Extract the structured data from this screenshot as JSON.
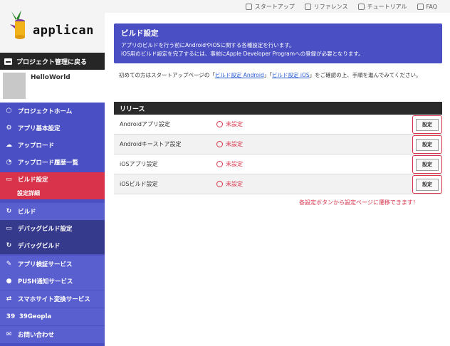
{
  "app": {
    "logo_text": "applican"
  },
  "topbar": {
    "links": [
      "スタートアップ",
      "リファレンス",
      "チュートリアル",
      "FAQ"
    ]
  },
  "sidebar": {
    "back_label": "プロジェクト管理に戻る",
    "project_name": "HelloWorld",
    "items": [
      {
        "label": "プロジェクトホーム",
        "icon": "cube-icon"
      },
      {
        "label": "アプリ基本設定",
        "icon": "gear-icon"
      },
      {
        "label": "アップロード",
        "icon": "cloud-upload-icon"
      },
      {
        "label": "アップロード履歴一覧",
        "icon": "history-icon"
      },
      {
        "label": "ビルド設定",
        "icon": "briefcase-icon"
      },
      {
        "label": "設定詳細",
        "icon": ""
      },
      {
        "label": "ビルド",
        "icon": "refresh-icon"
      },
      {
        "label": "デバッグビルド設定",
        "icon": "briefcase-icon"
      },
      {
        "label": "デバッグビルド",
        "icon": "refresh-icon"
      },
      {
        "label": "アプリ検証サービス",
        "icon": "wrench-icon"
      },
      {
        "label": "PUSH通知サービス",
        "icon": "chat-icon"
      },
      {
        "label": "スマホサイト変換サービス",
        "icon": "convert-icon"
      },
      {
        "label": "39Geopla",
        "icon": "39"
      },
      {
        "label": "お問い合わせ",
        "icon": "mail-icon"
      }
    ]
  },
  "banner": {
    "title": "ビルド設定",
    "line1": "アプリのビルドを行う前にAndroidやiOSに関する各種設定を行います。",
    "line2": "iOS用のビルド設定を完了するには、事前にApple Developer Programへの登録が必要となります。"
  },
  "intro": {
    "pre": "初めての方はスタートアップページの「",
    "link1": "ビルド設定 Android",
    "mid": "」「",
    "link2": "ビルド設定 iOS",
    "post": "」をご確認の上、手順を進んでみてください。"
  },
  "release": {
    "title": "リリース",
    "rows": [
      {
        "name": "Androidアプリ設定",
        "status": "未設定"
      },
      {
        "name": "Androidキーストア設定",
        "status": "未設定"
      },
      {
        "name": "iOSアプリ設定",
        "status": "未設定"
      },
      {
        "name": "iOSビルド設定",
        "status": "未設定"
      }
    ],
    "button_label": "設定"
  },
  "hint": "各設定ボタンから設定ページに遷移できます！",
  "colors": {
    "accent": "#4a4fc4",
    "active": "#d8334a",
    "dark": "#2b2b2b"
  }
}
